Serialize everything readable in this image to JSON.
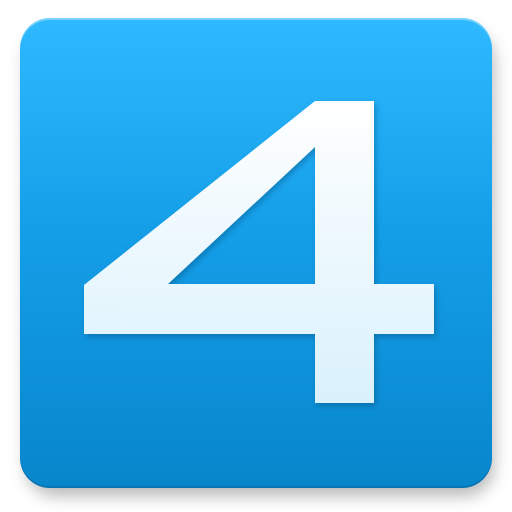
{
  "icon": {
    "name": "app-icon-4",
    "glyph": "4",
    "colors": {
      "tile_top": "#1db3ff",
      "tile_bottom": "#0886cc",
      "glyph_top": "#ffffff",
      "glyph_bottom": "#d9f1fc"
    }
  }
}
